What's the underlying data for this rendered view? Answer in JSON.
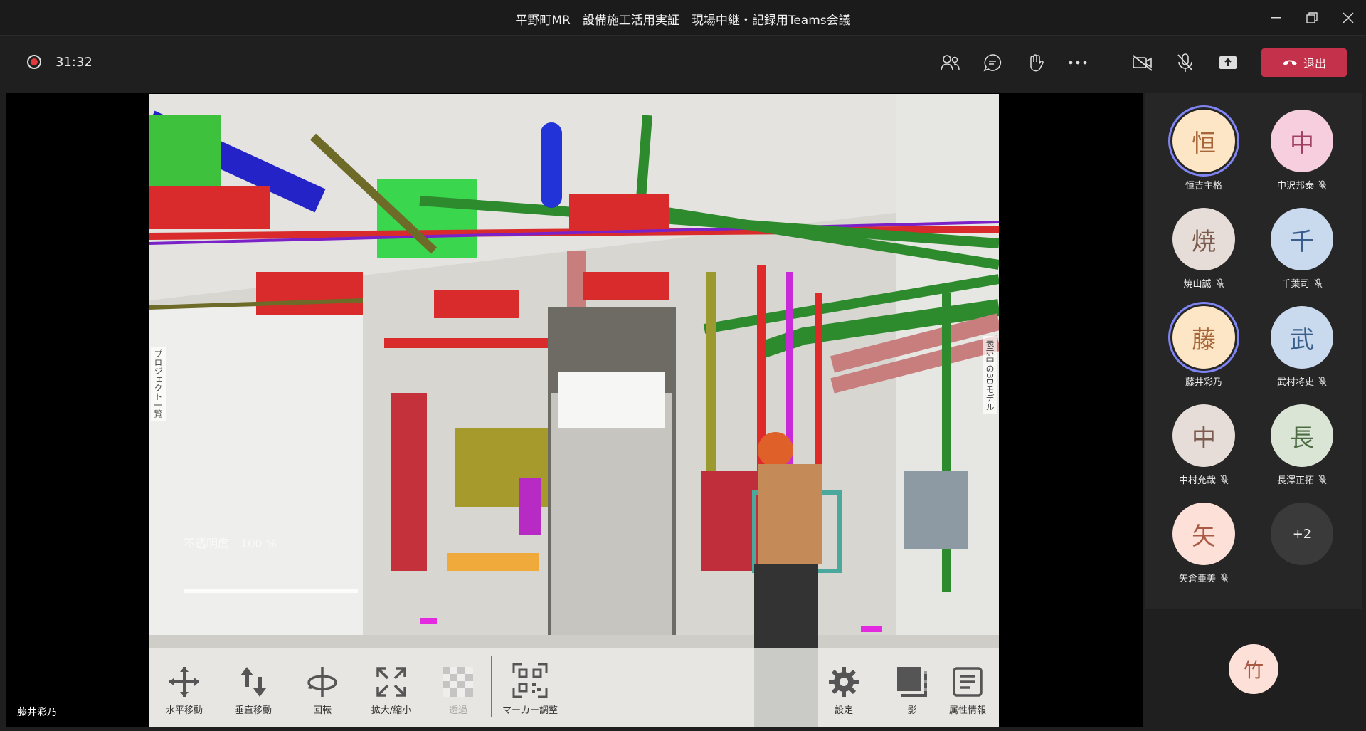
{
  "window": {
    "title": "平野町MR　設備施工活用実証　現場中継・記録用Teams会議"
  },
  "call": {
    "elapsed": "31:32",
    "leave_label": "退出"
  },
  "video": {
    "caption": "藤井彩乃",
    "opacity_label": "不透明度　100 %",
    "side_label_left": "プロジェクト一覧",
    "side_label_right": "表示中の3Dモデル",
    "tools": [
      {
        "label": "水平移動",
        "icon": "move-icon"
      },
      {
        "label": "垂直移動",
        "icon": "vertical-move-icon"
      },
      {
        "label": "回転",
        "icon": "rotate-icon"
      },
      {
        "label": "拡大/縮小",
        "icon": "scale-icon"
      },
      {
        "label": "透過",
        "icon": "transparency-icon"
      },
      {
        "label": "マーカー調整",
        "icon": "qr-icon"
      },
      {
        "label": "設定",
        "icon": "gear-icon"
      },
      {
        "label": "影",
        "icon": "shadow-icon"
      },
      {
        "label": "属性情報",
        "icon": "attributes-icon"
      }
    ]
  },
  "participants": [
    {
      "initial": "恒",
      "name": "恒吉主格",
      "muted": false,
      "speaking": true,
      "bg": "#fde6c6",
      "fg": "#a8673a"
    },
    {
      "initial": "中",
      "name": "中沢邦泰",
      "muted": true,
      "speaking": false,
      "bg": "#f6cede",
      "fg": "#a0405e"
    },
    {
      "initial": "焼",
      "name": "焼山誠",
      "muted": true,
      "speaking": false,
      "bg": "#e7ddd8",
      "fg": "#7a5b4e"
    },
    {
      "initial": "千",
      "name": "千葉司",
      "muted": true,
      "speaking": false,
      "bg": "#c9d9ee",
      "fg": "#3a5e8c"
    },
    {
      "initial": "藤",
      "name": "藤井彩乃",
      "muted": false,
      "speaking": true,
      "bg": "#fde6c6",
      "fg": "#a8673a"
    },
    {
      "initial": "武",
      "name": "武村将史",
      "muted": true,
      "speaking": false,
      "bg": "#c9d9ee",
      "fg": "#3a5e8c"
    },
    {
      "initial": "中",
      "name": "中村允哉",
      "muted": true,
      "speaking": false,
      "bg": "#e7ddd8",
      "fg": "#7a5b4e"
    },
    {
      "initial": "長",
      "name": "長澤正拓",
      "muted": true,
      "speaking": false,
      "bg": "#dbe5d6",
      "fg": "#4d6b43"
    },
    {
      "initial": "矢",
      "name": "矢倉亜美",
      "muted": true,
      "speaking": false,
      "bg": "#fde0d8",
      "fg": "#a85a45"
    }
  ],
  "overflow_count": "+2",
  "self": {
    "initial": "竹"
  },
  "colors": {
    "leave": "#c4314b",
    "speaking_ring": "#7f85f5",
    "recording": "#e03a3e"
  }
}
